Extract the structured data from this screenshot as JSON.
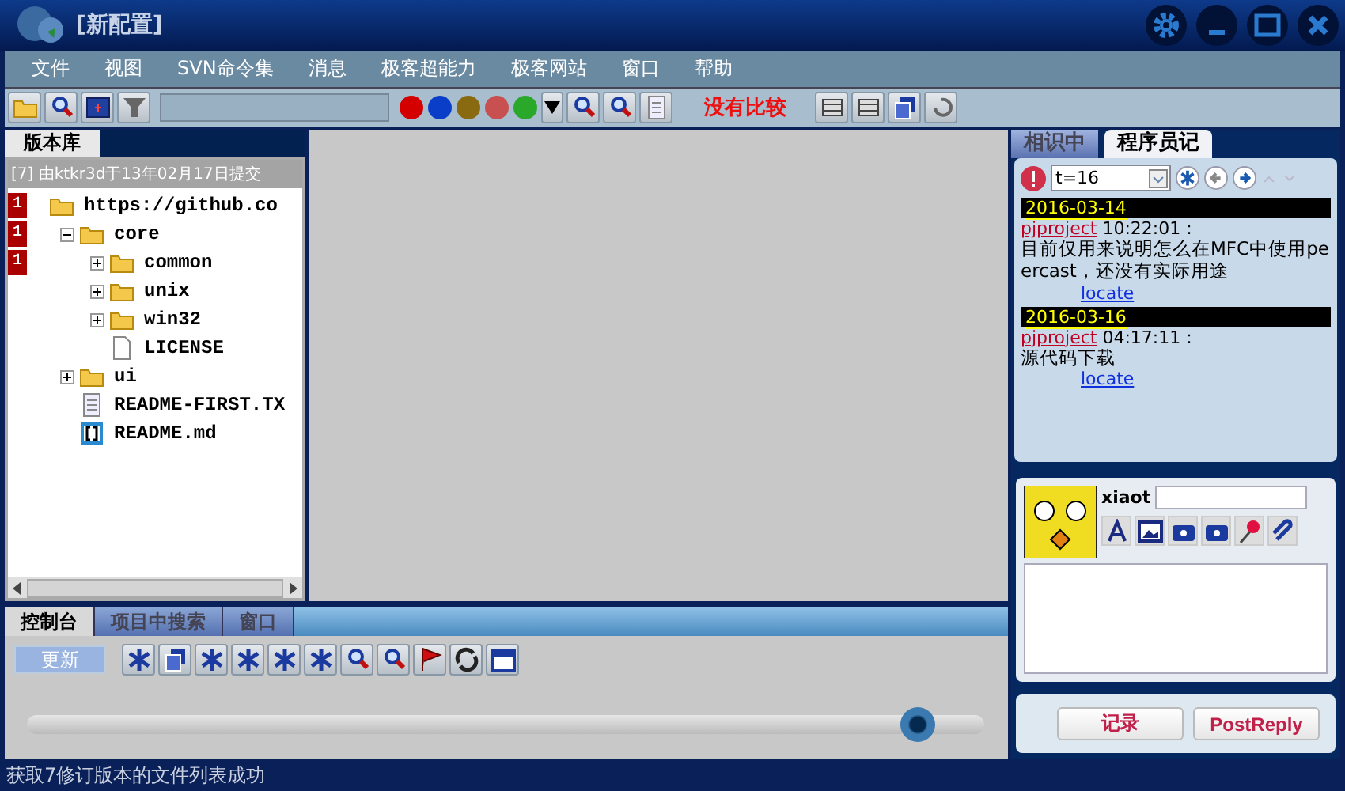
{
  "window": {
    "title": "[新配置]"
  },
  "menu": [
    "文件",
    "视图",
    "SVN命令集",
    "消息",
    "极客超能力",
    "极客网站",
    "窗口",
    "帮助"
  ],
  "toolbar": {
    "status_text": "没有比较"
  },
  "repo_panel": {
    "tabs": [
      {
        "label": "版本库",
        "selected": true
      }
    ],
    "header": "[7] 由ktkr3d于13年02月17日提交",
    "tree": [
      {
        "label": "https://github.co",
        "kind": "folder",
        "badge": "1",
        "children": [
          {
            "label": "core",
            "kind": "folder",
            "badge": "1",
            "expanded": true,
            "children": [
              {
                "label": "common",
                "kind": "folder",
                "badge": "1",
                "expanded": false
              },
              {
                "label": "unix",
                "kind": "folder",
                "expanded": false
              },
              {
                "label": "win32",
                "kind": "folder",
                "expanded": false
              },
              {
                "label": "LICENSE",
                "kind": "file"
              }
            ]
          },
          {
            "label": "ui",
            "kind": "folder",
            "expanded": false
          },
          {
            "label": "README-FIRST.TX",
            "kind": "text"
          },
          {
            "label": "README.md",
            "kind": "markdown"
          }
        ]
      }
    ]
  },
  "console": {
    "tabs": [
      {
        "label": "控制台",
        "selected": true
      },
      {
        "label": "项目中搜索",
        "selected": false
      },
      {
        "label": "窗口",
        "selected": false
      }
    ],
    "update_button": "更新",
    "slider": {
      "level": 0.93
    }
  },
  "notes_panel": {
    "tabs": [
      {
        "label": "相识中",
        "selected": false
      },
      {
        "label": "程序员记",
        "selected": true
      }
    ],
    "filter": "t=16",
    "entries": [
      {
        "date": "2016-03-14",
        "author": "pjproject",
        "time": "10:22:01 :",
        "text": "目前仅用来说明怎么在MFC中使用peercast，还没有实际用途",
        "link": "locate"
      },
      {
        "date": "2016-03-16",
        "author": "pjproject",
        "time": "04:17:11 :",
        "text": "源代码下载",
        "link": "locate"
      }
    ],
    "user": "xiaot",
    "buttons": [
      "记录",
      "PostReply"
    ]
  },
  "status_bar": "获取7修订版本的文件列表成功"
}
